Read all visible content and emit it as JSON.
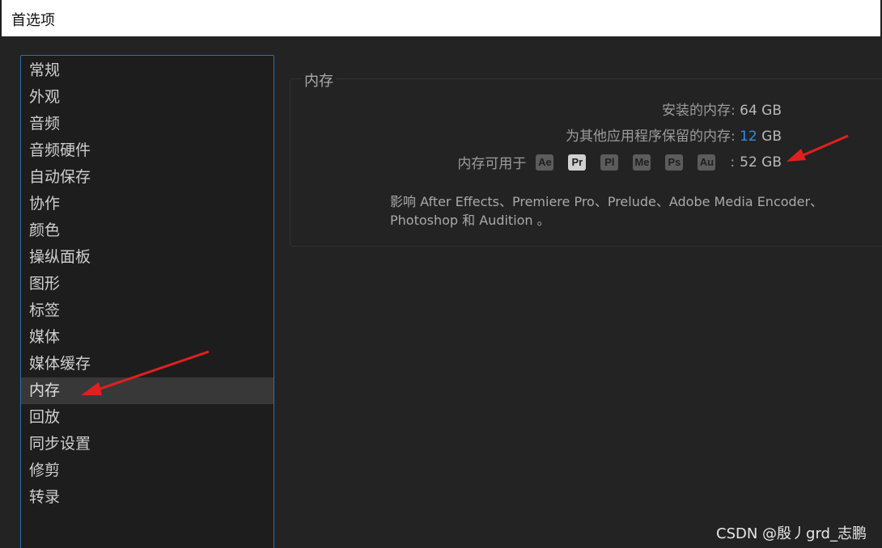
{
  "window": {
    "title": "首选项"
  },
  "sidebar": {
    "items": [
      {
        "label": "常规"
      },
      {
        "label": "外观"
      },
      {
        "label": "音频"
      },
      {
        "label": "音频硬件"
      },
      {
        "label": "自动保存"
      },
      {
        "label": "协作"
      },
      {
        "label": "颜色"
      },
      {
        "label": "操纵面板"
      },
      {
        "label": "图形"
      },
      {
        "label": "标签"
      },
      {
        "label": "媒体"
      },
      {
        "label": "媒体缓存"
      },
      {
        "label": "内存"
      },
      {
        "label": "回放"
      },
      {
        "label": "同步设置"
      },
      {
        "label": "修剪"
      },
      {
        "label": "转录"
      }
    ],
    "selected": "内存"
  },
  "memory": {
    "group_title": "内存",
    "installed_label": "安装的内存:",
    "installed_value": "64 GB",
    "reserved_label": "为其他应用程序保留的内存:",
    "reserved_value": "12",
    "reserved_unit": "GB",
    "available_label": "内存可用于",
    "apps": [
      "Ae",
      "Pr",
      "Pl",
      "Me",
      "Ps",
      "Au"
    ],
    "active_app": "Pr",
    "available_sep": ":",
    "available_value": "52 GB",
    "description": "影响 After Effects、Premiere Pro、Prelude、Adobe Media Encoder、Photoshop 和 Audition 。"
  },
  "watermark": "CSDN @殷丿grd_志鹏",
  "colors": {
    "background": "#232323",
    "sidebar_border": "#2f6fb6",
    "accent_blue": "#2f8de0",
    "arrow": "#e02020"
  }
}
